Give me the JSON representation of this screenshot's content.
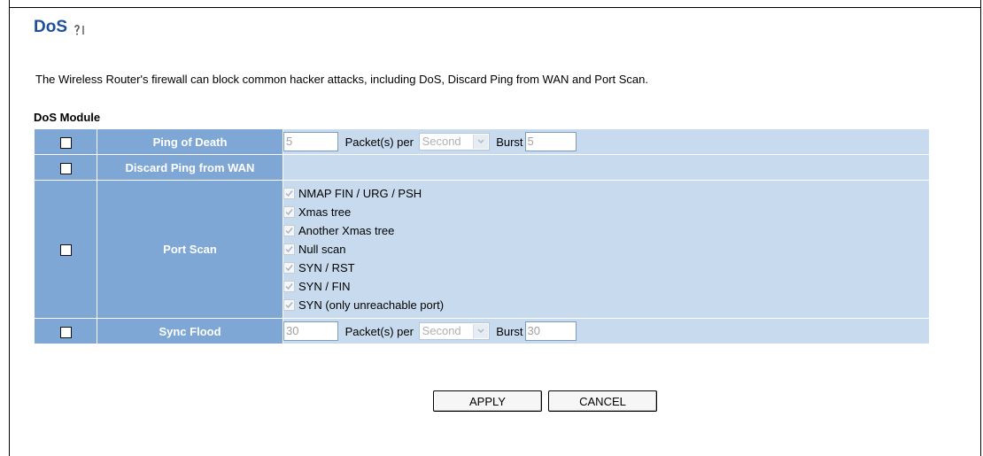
{
  "page": {
    "title": "DoS",
    "description": "The Wireless Router's firewall can block common hacker attacks, including DoS, Discard Ping from WAN and Port Scan.",
    "module_label": "DoS Module"
  },
  "rows": {
    "ping_of_death": {
      "label": "Ping of Death",
      "rate_value": "5",
      "per_label": "Packet(s) per",
      "unit": "Second",
      "burst_label": "Burst",
      "burst_value": "5",
      "enabled": false
    },
    "discard_ping": {
      "label": "Discard Ping from WAN",
      "enabled": false
    },
    "port_scan": {
      "label": "Port Scan",
      "enabled": false,
      "options": [
        "NMAP FIN / URG / PSH",
        "Xmas tree",
        "Another Xmas tree",
        "Null scan",
        "SYN / RST",
        "SYN / FIN",
        "SYN (only unreachable port)"
      ]
    },
    "sync_flood": {
      "label": "Sync Flood",
      "rate_value": "30",
      "per_label": "Packet(s) per",
      "unit": "Second",
      "burst_label": "Burst",
      "burst_value": "30",
      "enabled": false
    }
  },
  "buttons": {
    "apply": "APPLY",
    "cancel": "CANCEL"
  },
  "colors": {
    "title": "#1f4e9a",
    "label_cell": "#7ea7d6",
    "value_cell": "#c8dbee"
  },
  "icons": {
    "help": "help-icon"
  }
}
